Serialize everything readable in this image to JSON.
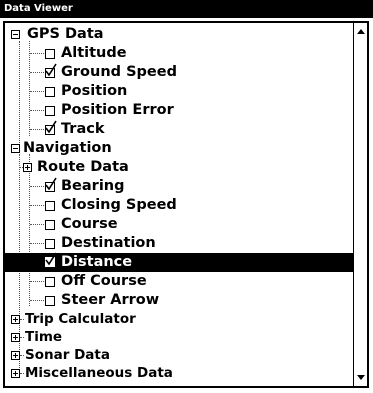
{
  "window": {
    "title": "Data Viewer"
  },
  "tree": {
    "gps_data": {
      "label": "GPS Data",
      "items": [
        {
          "label": "Altitude",
          "checked": false
        },
        {
          "label": "Ground Speed",
          "checked": true
        },
        {
          "label": "Position",
          "checked": false
        },
        {
          "label": "Position Error",
          "checked": false
        },
        {
          "label": "Track",
          "checked": true
        }
      ]
    },
    "navigation": {
      "label": "Navigation",
      "route_data": "Route Data",
      "items": [
        {
          "label": "Bearing",
          "checked": true
        },
        {
          "label": "Closing Speed",
          "checked": false
        },
        {
          "label": "Course",
          "checked": false
        },
        {
          "label": "Destination",
          "checked": false
        },
        {
          "label": "Distance",
          "checked": true,
          "selected": true
        },
        {
          "label": "Off Course",
          "checked": false
        },
        {
          "label": "Steer Arrow",
          "checked": false
        }
      ]
    },
    "collapsed": [
      "Trip Calculator",
      "Time",
      "Sonar Data",
      "Miscellaneous Data"
    ]
  }
}
